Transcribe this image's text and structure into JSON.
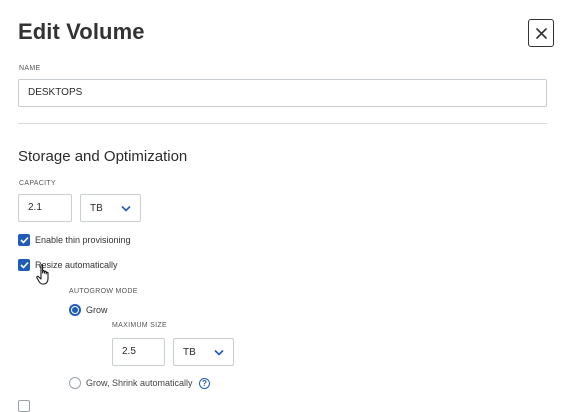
{
  "dialog": {
    "title": "Edit Volume",
    "close_icon": "close-icon"
  },
  "name": {
    "label": "NAME",
    "value": "DESKTOPS"
  },
  "storage": {
    "section_title": "Storage and Optimization",
    "capacity_label": "CAPACITY",
    "capacity_value": "2.1",
    "capacity_unit": "TB",
    "thin_provisioning": {
      "label": "Enable thin provisioning",
      "checked": true
    },
    "resize_automatically": {
      "label": "Resize automatically",
      "checked": true
    },
    "autogrow": {
      "label": "AUTOGROW MODE",
      "options": [
        {
          "label": "Grow",
          "selected": true
        },
        {
          "label": "Grow, Shrink automatically",
          "selected": false
        }
      ],
      "max_size_label": "MAXIMUM SIZE",
      "max_size_value": "2.5",
      "max_size_unit": "TB",
      "help_icon": "help-icon",
      "help_glyph": "?"
    }
  },
  "colors": {
    "accent": "#1f5bb8",
    "border": "#c9ced3",
    "text": "#2b2b2b"
  }
}
